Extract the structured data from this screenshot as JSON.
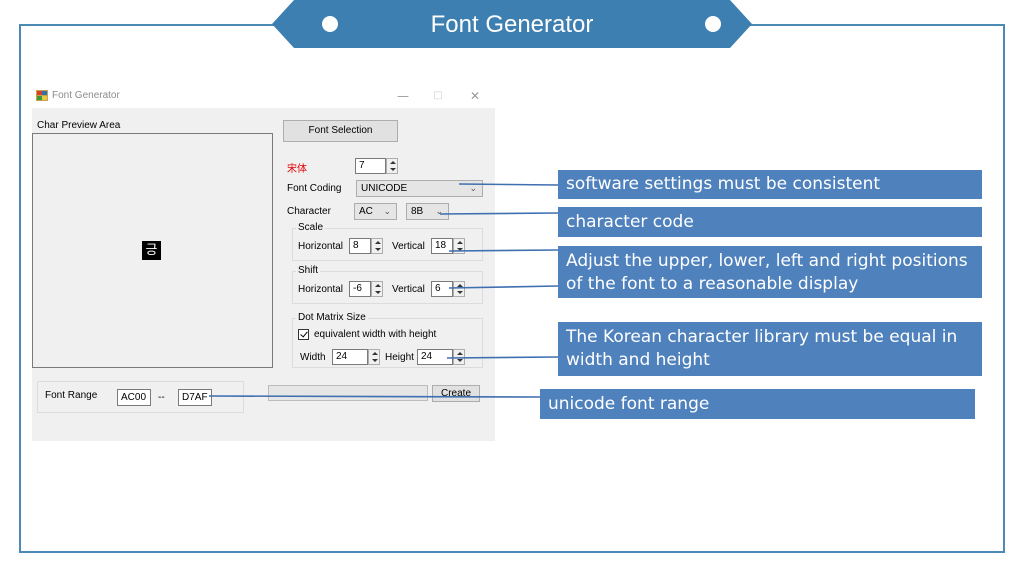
{
  "slide": {
    "title": "Font Generator"
  },
  "window": {
    "title": "Font Generator",
    "minimize": "—",
    "maximize": "□",
    "close": "✕"
  },
  "preview": {
    "label": "Char Preview Area",
    "glyph": "긍"
  },
  "font_selection_button": "Font Selection",
  "font": {
    "name": "宋体",
    "size": "7"
  },
  "font_coding": {
    "label": "Font Coding",
    "value": "UNICODE"
  },
  "character": {
    "label": "Character",
    "high": "AC",
    "low": "8B"
  },
  "scale": {
    "title": "Scale",
    "horizontal_label": "Horizontal",
    "horizontal": "8",
    "vertical_label": "Vertical",
    "vertical": "18"
  },
  "shift": {
    "title": "Shift",
    "horizontal_label": "Horizontal",
    "horizontal": "-6",
    "vertical_label": "Vertical",
    "vertical": "6"
  },
  "dot_matrix": {
    "title": "Dot Matrix Size",
    "checkbox_label": "equivalent width with height",
    "checked": true,
    "width_label": "Width",
    "width": "24",
    "height_label": "Height",
    "height": "24"
  },
  "font_range": {
    "label": "Font Range",
    "from": "AC00",
    "separator": "--",
    "to": "D7AF"
  },
  "create_button": "Create",
  "callouts": {
    "settings": "software settings must be consistent",
    "char_code": "character code",
    "adjust": "Adjust the upper, lower, left and right positions of the font to a reasonable display",
    "korean": "The Korean character library must be equal in width and height",
    "range": "unicode font range"
  },
  "colors": {
    "banner": "#3e7fb1",
    "frame": "#4a8ab5",
    "callout": "#4f81bd",
    "font_name": "#e00000"
  }
}
